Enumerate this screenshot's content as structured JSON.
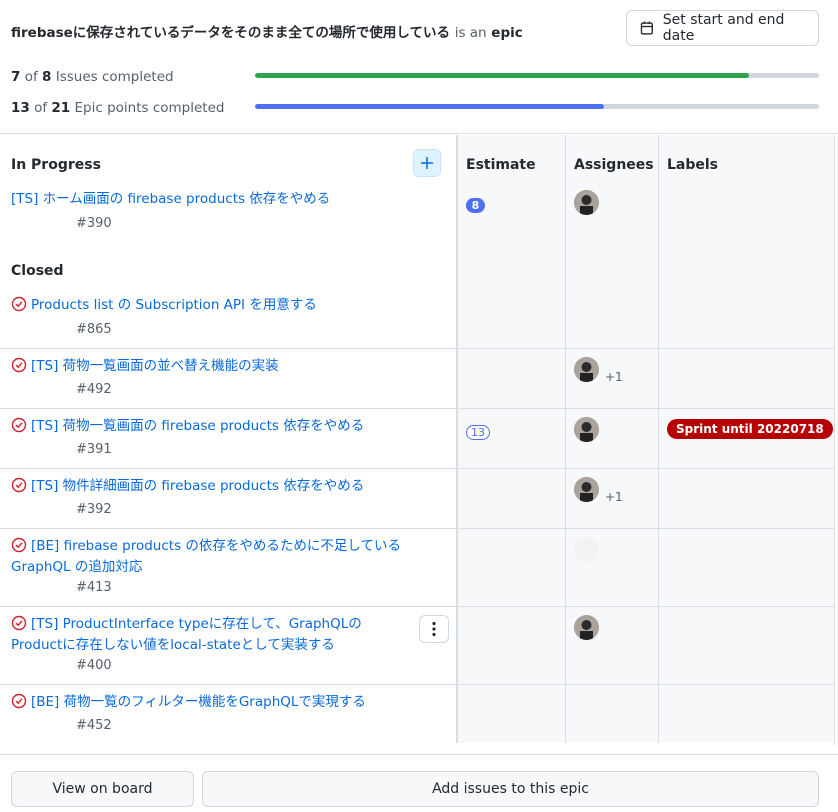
{
  "header": {
    "epic_title": "firebaseに保存されているデータをそのまま全ての場所で使用している",
    "is_an": "is an",
    "epic_word": "epic",
    "date_button": "Set start and end date"
  },
  "progress": {
    "issues": {
      "done": "7",
      "of": "of",
      "total": "8",
      "label": "Issues completed",
      "fraction": 0.875,
      "color": "#2da44e"
    },
    "points": {
      "done": "13",
      "of": "of",
      "total": "21",
      "label": "Epic points completed",
      "fraction": 0.619,
      "color": "#4f6ff0"
    }
  },
  "columns": {
    "estimate": "Estimate",
    "assignees": "Assignees",
    "labels": "Labels"
  },
  "sections": {
    "in_progress": "In Progress",
    "closed": "Closed"
  },
  "issues": [
    {
      "title": "[TS] ホーム画面の firebase products 依存をやめる",
      "number": "#390",
      "estimate": "8",
      "extra": ""
    },
    {
      "title": "Products list の Subscription API を用意する",
      "number": "#865",
      "estimate": "",
      "extra": ""
    },
    {
      "title": "[TS] 荷物一覧画面の並べ替え機能の実装",
      "number": "#492",
      "estimate": "",
      "extra": "+1"
    },
    {
      "title": "[TS] 荷物一覧画面の firebase products 依存をやめる",
      "number": "#391",
      "estimate": "13",
      "extra": "",
      "label": "Sprint until 20220718"
    },
    {
      "title": "[TS] 物件詳細画面の firebase products 依存をやめる",
      "number": "#392",
      "estimate": "",
      "extra": "+1"
    },
    {
      "title_line1": "[BE] firebase products の依存をやめるために不足している",
      "title_line2": "GraphQL の追加対応",
      "number": "#413"
    },
    {
      "title_line1": "[TS] ProductInterface typeに存在して、GraphQLの",
      "title_line2": "Productに存在しない値をlocal-stateとして実装する",
      "number": "#400"
    },
    {
      "title": "[BE] 荷物一覧のフィルター機能をGraphQLで実現する",
      "number": "#452"
    }
  ],
  "footer": {
    "view_board": "View on board",
    "add_issues": "Add issues to this epic"
  },
  "colors": {
    "link": "#0969da",
    "closed_red": "#cf222e",
    "label_red": "#b60205"
  }
}
